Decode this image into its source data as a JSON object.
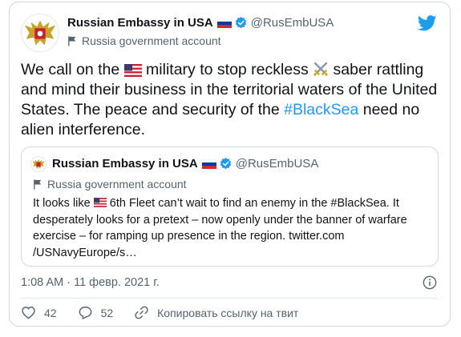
{
  "tweet": {
    "author_name": "Russian Embassy in USA",
    "handle": "@RusEmbUSA",
    "gov_label": "Russia government account",
    "text_parts": {
      "p1": "We call on the ",
      "p2": " military to stop reckless ",
      "p3": " saber rattling and mind their business in the territorial waters of the United States. The peace and security of the ",
      "hashtag": "#BlackSea",
      "p4": " need no alien interference."
    },
    "timestamp": "1:08 AM · 11 февр. 2021 г."
  },
  "quoted_tweet": {
    "author_name": "Russian Embassy in USA",
    "handle": "@RusEmbUSA",
    "gov_label": "Russia government account",
    "text_parts": {
      "p1": "It looks like ",
      "p2": " 6th Fleet can’t wait to find an enemy in the #BlackSea. It desperately looks for a pretext – now openly under the banner of warfare exercise – for ramping up presence in the region. twitter.com /USNavyEurope/s…"
    }
  },
  "actions": {
    "likes": "42",
    "replies": "52",
    "copy_link": "Копировать ссылку на твит"
  },
  "icons": {
    "brand": "twitter-bird-icon",
    "verified": "verified-badge-icon",
    "gov": "flag-icon",
    "like": "heart-icon",
    "reply": "reply-icon",
    "link": "link-icon",
    "info": "info-icon"
  },
  "colors": {
    "accent": "#1d9bf0",
    "text": "#0f1419",
    "muted": "#536471",
    "border": "#cfd9de"
  }
}
